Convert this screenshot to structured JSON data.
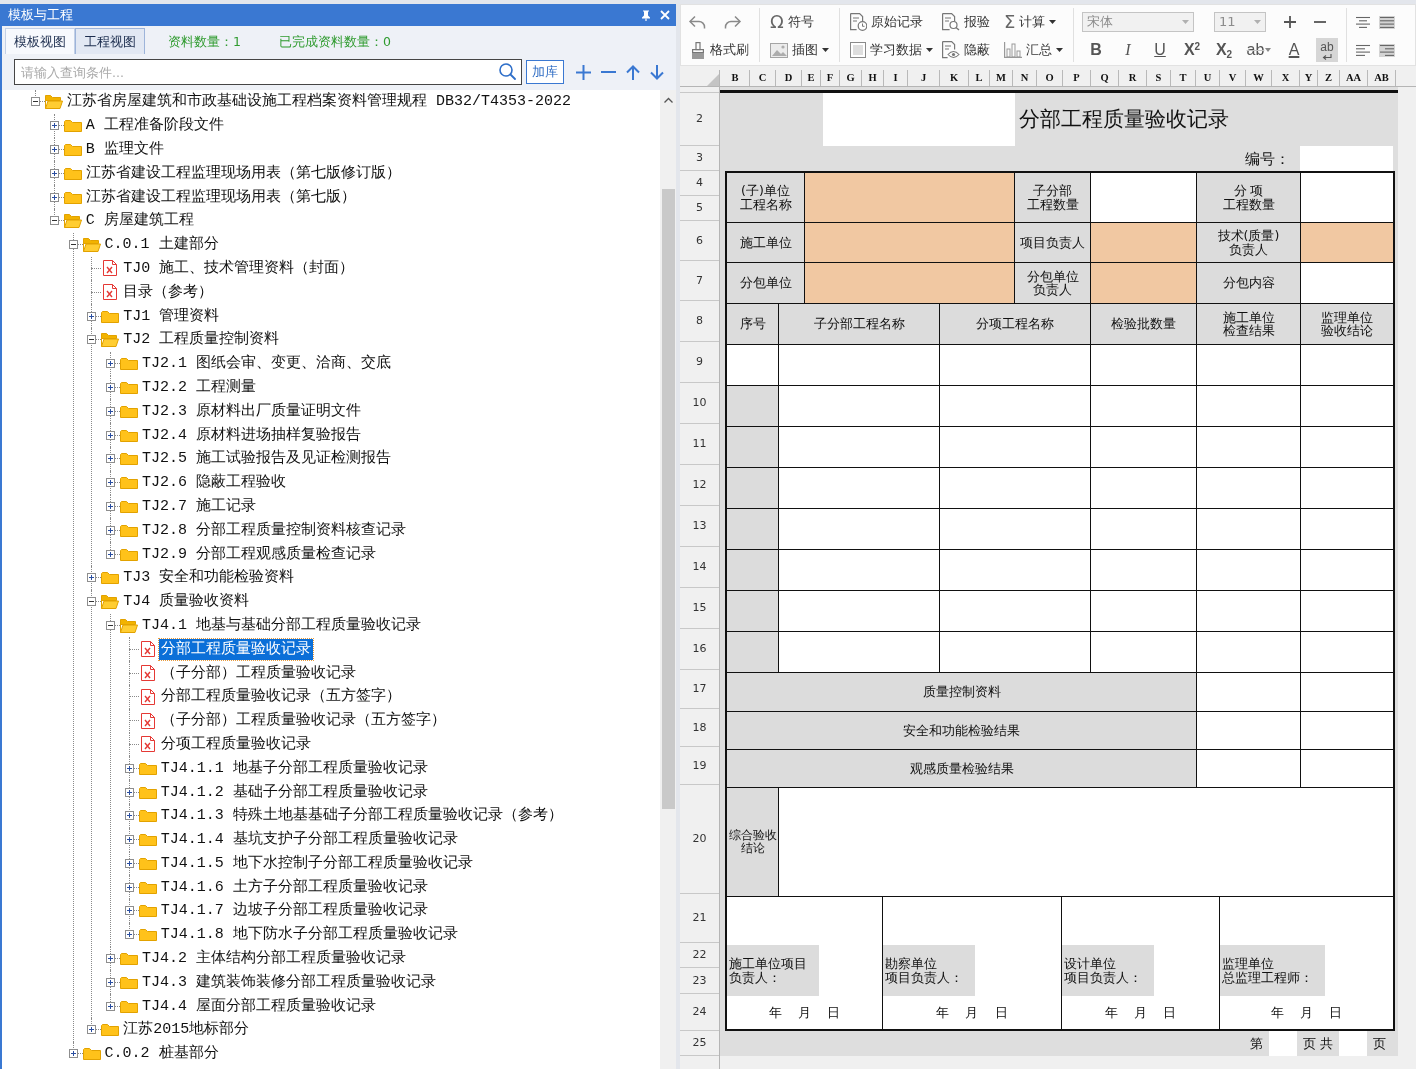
{
  "panel": {
    "title": "模板与工程"
  },
  "tabs": [
    {
      "label": "模板视图",
      "selected": true
    },
    {
      "label": "工程视图",
      "selected": false
    }
  ],
  "stats": [
    "资料数量：1",
    "已完成资料数量：0"
  ],
  "search": {
    "placeholder": "请输入查询条件...",
    "button": "加库"
  },
  "tree": [
    {
      "label": "江苏省房屋建筑和市政基础设施工程档案资料管理规程 DB32/T4353-2022",
      "kind": "folder",
      "expanded": true,
      "selected": false,
      "children": [
        {
          "label": "A 工程准备阶段文件",
          "kind": "folder",
          "expanded": false,
          "selected": false
        },
        {
          "label": "B 监理文件",
          "kind": "folder",
          "expanded": false,
          "selected": false
        },
        {
          "label": "江苏省建设工程监理现场用表（第七版修订版）",
          "kind": "folder",
          "expanded": false,
          "selected": false
        },
        {
          "label": "江苏省建设工程监理现场用表（第七版）",
          "kind": "folder",
          "expanded": false,
          "selected": false
        },
        {
          "label": "C 房屋建筑工程",
          "kind": "folder",
          "expanded": true,
          "selected": false,
          "children": [
            {
              "label": "C.0.1 土建部分",
              "kind": "folder",
              "expanded": true,
              "selected": false,
              "children": [
                {
                  "label": "TJ0 施工、技术管理资料（封面）",
                  "kind": "document",
                  "selected": false
                },
                {
                  "label": "目录（参考）",
                  "kind": "document",
                  "selected": false
                },
                {
                  "label": "TJ1 管理资料",
                  "kind": "folder",
                  "expanded": false,
                  "selected": false
                },
                {
                  "label": "TJ2 工程质量控制资料",
                  "kind": "folder",
                  "expanded": true,
                  "selected": false,
                  "children": [
                    {
                      "label": "TJ2.1 图纸会审、变更、洽商、交底",
                      "kind": "folder",
                      "expanded": false,
                      "selected": false
                    },
                    {
                      "label": "TJ2.2 工程测量",
                      "kind": "folder",
                      "expanded": false,
                      "selected": false
                    },
                    {
                      "label": "TJ2.3 原材料出厂质量证明文件",
                      "kind": "folder",
                      "expanded": false,
                      "selected": false
                    },
                    {
                      "label": "TJ2.4 原材料进场抽样复验报告",
                      "kind": "folder",
                      "expanded": false,
                      "selected": false
                    },
                    {
                      "label": "TJ2.5 施工试验报告及见证检测报告",
                      "kind": "folder",
                      "expanded": false,
                      "selected": false
                    },
                    {
                      "label": "TJ2.6 隐蔽工程验收",
                      "kind": "folder",
                      "expanded": false,
                      "selected": false
                    },
                    {
                      "label": "TJ2.7 施工记录",
                      "kind": "folder",
                      "expanded": false,
                      "selected": false
                    },
                    {
                      "label": "TJ2.8 分部工程质量控制资料核查记录",
                      "kind": "folder",
                      "expanded": false,
                      "selected": false
                    },
                    {
                      "label": "TJ2.9 分部工程观感质量检查记录",
                      "kind": "folder",
                      "expanded": false,
                      "selected": false
                    }
                  ]
                },
                {
                  "label": "TJ3 安全和功能检验资料",
                  "kind": "folder",
                  "expanded": false,
                  "selected": false
                },
                {
                  "label": "TJ4 质量验收资料",
                  "kind": "folder",
                  "expanded": true,
                  "selected": false,
                  "children": [
                    {
                      "label": "TJ4.1 地基与基础分部工程质量验收记录",
                      "kind": "folder",
                      "expanded": true,
                      "selected": false,
                      "children": [
                        {
                          "label": "分部工程质量验收记录",
                          "kind": "document",
                          "selected": true
                        },
                        {
                          "label": "（子分部）工程质量验收记录",
                          "kind": "document",
                          "selected": false
                        },
                        {
                          "label": "分部工程质量验收记录（五方签字）",
                          "kind": "document",
                          "selected": false
                        },
                        {
                          "label": "（子分部）工程质量验收记录（五方签字）",
                          "kind": "document",
                          "selected": false
                        },
                        {
                          "label": "分项工程质量验收记录",
                          "kind": "document",
                          "selected": false
                        },
                        {
                          "label": "TJ4.1.1 地基子分部工程质量验收记录",
                          "kind": "folder",
                          "expanded": false,
                          "selected": false
                        },
                        {
                          "label": "TJ4.1.2 基础子分部工程质量验收记录",
                          "kind": "folder",
                          "expanded": false,
                          "selected": false
                        },
                        {
                          "label": "TJ4.1.3 特殊土地基基础子分部工程质量验收记录（参考）",
                          "kind": "folder",
                          "expanded": false,
                          "selected": false
                        },
                        {
                          "label": "TJ4.1.4 基坑支护子分部工程质量验收记录",
                          "kind": "folder",
                          "expanded": false,
                          "selected": false
                        },
                        {
                          "label": "TJ4.1.5 地下水控制子分部工程质量验收记录",
                          "kind": "folder",
                          "expanded": false,
                          "selected": false
                        },
                        {
                          "label": "TJ4.1.6 土方子分部工程质量验收记录",
                          "kind": "folder",
                          "expanded": false,
                          "selected": false
                        },
                        {
                          "label": "TJ4.1.7 边坡子分部工程质量验收记录",
                          "kind": "folder",
                          "expanded": false,
                          "selected": false
                        },
                        {
                          "label": "TJ4.1.8 地下防水子分部工程质量验收记录",
                          "kind": "folder",
                          "expanded": false,
                          "selected": false
                        }
                      ]
                    },
                    {
                      "label": "TJ4.2 主体结构分部工程质量验收记录",
                      "kind": "folder",
                      "expanded": false,
                      "selected": false
                    },
                    {
                      "label": "TJ4.3 建筑装饰装修分部工程质量验收记录",
                      "kind": "folder",
                      "expanded": false,
                      "selected": false
                    },
                    {
                      "label": "TJ4.4 屋面分部工程质量验收记录",
                      "kind": "folder",
                      "expanded": false,
                      "selected": false
                    }
                  ]
                },
                {
                  "label": "江苏2015地标部分",
                  "kind": "folder",
                  "expanded": false,
                  "selected": false
                }
              ]
            },
            {
              "label": "C.0.2 桩基部分",
              "kind": "folder",
              "expanded": false,
              "selected": false
            }
          ]
        }
      ]
    }
  ],
  "toolbar": {
    "buttons": [
      {
        "glyph": "Ω",
        "label": "符号"
      },
      {
        "label": "原始记录"
      },
      {
        "label": "报验"
      },
      {
        "glyph": "Σ",
        "label": "计算",
        "dropdown": true
      },
      {
        "label": "格式刷"
      },
      {
        "label": "插图",
        "dropdown": true
      },
      {
        "label": "学习数据",
        "dropdown": true
      },
      {
        "label": "隐蔽"
      },
      {
        "label": "汇总",
        "dropdown": true
      }
    ],
    "font": {
      "value": "宋体",
      "disabled": true
    },
    "size": {
      "value": "11",
      "disabled": true
    },
    "format_buttons": [
      {
        "kind": "bold",
        "label": "B"
      },
      {
        "kind": "italic",
        "label": "I"
      },
      {
        "kind": "underline",
        "label": "U"
      },
      {
        "kind": "superscript",
        "label": "X$^{2}$"
      },
      {
        "kind": "subscript",
        "label": "X$_{2}$"
      },
      {
        "kind": "strikethrough",
        "label": "ab",
        "dropdown": true
      },
      {
        "kind": "font-color",
        "label": "A"
      },
      {
        "kind": "wrap",
        "label": "ab"
      }
    ]
  },
  "sheet": {
    "columns": [
      "B",
      "C",
      "D",
      "E",
      "F",
      "G",
      "H",
      "I",
      "J",
      "K",
      "L",
      "M",
      "N",
      "O",
      "P",
      "Q",
      "R",
      "S",
      "T",
      "U",
      "V",
      "W",
      "X",
      "Y",
      "Z",
      "AA",
      "AB"
    ],
    "rows": [
      "2",
      "3",
      "4",
      "5",
      "6",
      "7",
      "8",
      "9",
      "10",
      "11",
      "12",
      "13",
      "14",
      "15",
      "16",
      "17",
      "18",
      "19",
      "20",
      "21",
      "22",
      "23",
      "24",
      "25"
    ],
    "form": {
      "title": "分部工程质量验收记录",
      "number_label": "编号：",
      "info_rows": [
        [
          {
            "lines": [
              "(子)单位",
              "工程名称"
            ],
            "highlighted": true
          },
          {
            "lines": [
              "子分部",
              "工程数量"
            ],
            "highlighted": false
          },
          {
            "lines": [
              "分 项",
              "工程数量"
            ],
            "highlighted": false
          }
        ],
        [
          {
            "lines": [
              "施工单位"
            ],
            "highlighted": true
          },
          {
            "lines": [
              "项目负责人"
            ],
            "highlighted": true
          },
          {
            "lines": [
              "技术(质量)",
              "负责人"
            ],
            "highlighted": true
          }
        ],
        [
          {
            "lines": [
              "分包单位"
            ],
            "highlighted": true
          },
          {
            "lines": [
              "分包单位",
              "负责人"
            ],
            "highlighted": true
          },
          {
            "lines": [
              "分包内容"
            ],
            "highlighted": false
          }
        ]
      ],
      "columns": [
        [
          "序号"
        ],
        [
          "子分部工程名称"
        ],
        [
          "分项工程名称"
        ],
        [
          "检验批数量"
        ],
        [
          "施工单位",
          "检查结果"
        ],
        [
          "监理单位",
          "验收结论"
        ]
      ],
      "entry_rows": [
        {
          "shaded": false
        },
        {
          "shaded": true
        },
        {
          "shaded": true
        },
        {
          "shaded": true
        },
        {
          "shaded": true
        },
        {
          "shaded": true
        },
        {
          "shaded": true
        },
        {
          "shaded": true
        }
      ],
      "summary_rows": [
        "质量控制资料",
        "安全和功能检验结果",
        "观感质量检验结果"
      ],
      "conclusion_label": "综合验收结论",
      "signatures": [
        {
          "lines": [
            "施工单位项目",
            "负责人："
          ],
          "date": "年 月 日"
        },
        {
          "lines": [
            "勘察单位",
            "项目负责人："
          ],
          "date": "年 月 日"
        },
        {
          "lines": [
            "设计单位",
            "项目负责人："
          ],
          "date": "年 月 日"
        },
        {
          "lines": [
            "监理单位",
            "总监理工程师："
          ],
          "date": "年 月 日"
        }
      ],
      "page_footer": [
        "第",
        "页 共",
        "页"
      ]
    }
  }
}
